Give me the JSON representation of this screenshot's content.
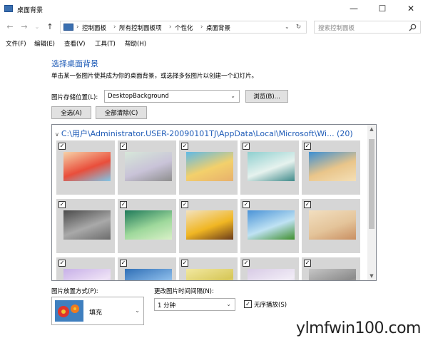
{
  "window": {
    "title": "桌面背景",
    "minimize": "—",
    "maximize": "☐",
    "close": "✕"
  },
  "nav": {
    "back": "←",
    "forward": "→",
    "up": "↑",
    "refresh": "↻"
  },
  "address": {
    "crumbs": [
      "控制面板",
      "所有控制面板项",
      "个性化",
      "桌面背景"
    ],
    "separator": "›"
  },
  "search": {
    "placeholder": "搜索控制面板"
  },
  "menu": [
    "文件(F)",
    "编辑(E)",
    "查看(V)",
    "工具(T)",
    "帮助(H)"
  ],
  "main": {
    "heading": "选择桌面背景",
    "description": "单击某一张图片使其成为你的桌面背景，或选择多张图片以创建一个幻灯片。",
    "location_label": "图片存储位置(L):",
    "location_value": "DesktopBackground",
    "browse_button": "浏览(B)...",
    "select_all_button": "全选(A)",
    "clear_all_button": "全部清除(C)"
  },
  "gallery": {
    "path": "C:\\用户\\Administrator.USER-20090101TJ\\AppData\\Local\\Microsoft\\Wi... (20)",
    "check": "✓",
    "thumbs": [
      {
        "icon": "cartoon-thumbnail",
        "colors": [
          "#f6d2a8",
          "#e94e3b",
          "#7fc6e8"
        ]
      },
      {
        "icon": "powerline-thumbnail",
        "colors": [
          "#d7e7d9",
          "#c9c3d8",
          "#8e8e8e"
        ]
      },
      {
        "icon": "beach-cartoon-thumbnail",
        "colors": [
          "#5fb9e6",
          "#f3d06b",
          "#e7b06d"
        ]
      },
      {
        "icon": "teal-abstract-thumbnail",
        "colors": [
          "#8fcfcf",
          "#e6f2ee",
          "#3f8a8a"
        ]
      },
      {
        "icon": "sand-heart-thumbnail",
        "colors": [
          "#3c8fd3",
          "#e9c58a",
          "#f4dfb6"
        ]
      },
      {
        "icon": "grey-scene-thumbnail",
        "colors": [
          "#4b4b4b",
          "#a9a9a9",
          "#6c6c6c"
        ]
      },
      {
        "icon": "green-light-thumbnail",
        "colors": [
          "#1f7a5a",
          "#9ed89b",
          "#d9f0c7"
        ]
      },
      {
        "icon": "sunflower-thumbnail",
        "colors": [
          "#f3e2bd",
          "#f0b623",
          "#6a3b1b"
        ]
      },
      {
        "icon": "meadow-thumbnail",
        "colors": [
          "#4a93d7",
          "#bfe2f3",
          "#3f8f2d"
        ]
      },
      {
        "icon": "beige-figure-thumbnail",
        "colors": [
          "#f2dfc0",
          "#e4c49a",
          "#c98f62"
        ]
      },
      {
        "icon": "purple-thumbnail",
        "colors": [
          "#c7b0e8",
          "#efe3f6",
          "#a98ad3"
        ]
      },
      {
        "icon": "blue-mist-thumbnail",
        "colors": [
          "#2f6fb6",
          "#86b7e6",
          "#d6e8f6"
        ]
      },
      {
        "icon": "yellow-field-thumbnail",
        "colors": [
          "#f2e8a0",
          "#d7c85a",
          "#fbf5d0"
        ]
      },
      {
        "icon": "lavender-thumbnail",
        "colors": [
          "#d8cbe6",
          "#f1ecf6",
          "#b9a4d2"
        ]
      },
      {
        "icon": "dusk-thumbnail",
        "colors": [
          "#c6c6c6",
          "#8c8c8c",
          "#efe6d6"
        ]
      }
    ]
  },
  "bottom": {
    "position_label": "图片放置方式(P):",
    "position_value": "填充",
    "interval_label": "更改图片时间间隔(N):",
    "interval_value": "1 分钟",
    "shuffle_label": "无序播放(S)",
    "shuffle_check": "✓"
  },
  "watermark": "ylmfwin100.com",
  "colors": {
    "accent": "#1e5bb7"
  }
}
